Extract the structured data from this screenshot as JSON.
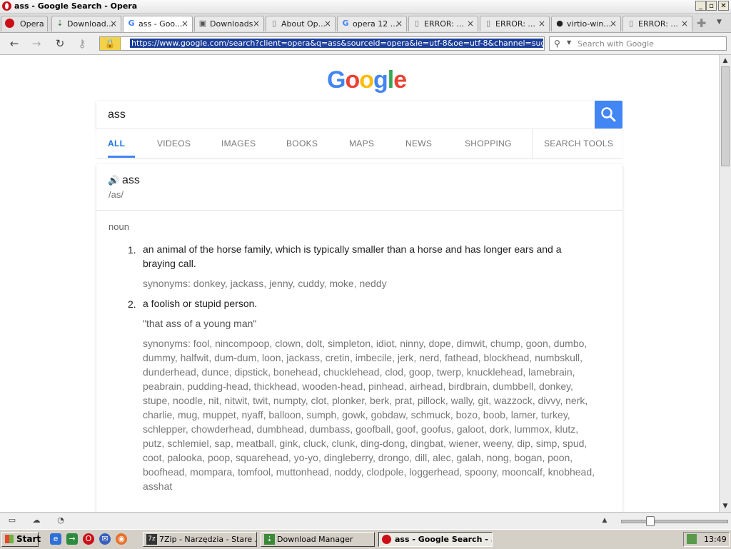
{
  "window": {
    "title": "ass - Google Search - Opera",
    "buttons": {
      "minimize": "_",
      "maximize": "▫",
      "close": "✕"
    }
  },
  "tabs": [
    {
      "label": "Opera",
      "icon": "opera-menu-icon"
    },
    {
      "label": "Download...",
      "icon": "download-icon"
    },
    {
      "label": "ass - Goo...",
      "icon": "google-icon",
      "active": true
    },
    {
      "label": "Downloads",
      "icon": "downloads-icon"
    },
    {
      "label": "About Op...",
      "icon": "page-icon"
    },
    {
      "label": "opera 12 ...",
      "icon": "google-icon"
    },
    {
      "label": "ERROR: ...",
      "icon": "page-icon"
    },
    {
      "label": "ERROR: ...",
      "icon": "page-icon"
    },
    {
      "label": "virtio-win...",
      "icon": "github-icon"
    },
    {
      "label": "ERROR: ...",
      "icon": "page-icon"
    }
  ],
  "addressbar": {
    "url": "https://www.google.com/search?client=opera&q=ass&sourceid=opera&ie=utf-8&oe=utf-8&channel=suggest&safe=ac",
    "search_placeholder": "Search with Google"
  },
  "google": {
    "logo": [
      "G",
      "o",
      "o",
      "g",
      "l",
      "e"
    ],
    "logo_colors": [
      "#4285f4",
      "#ea4335",
      "#fbbc05",
      "#4285f4",
      "#34a853",
      "#ea4335"
    ],
    "query": "ass",
    "tabs": [
      "ALL",
      "VIDEOS",
      "IMAGES",
      "BOOKS",
      "MAPS",
      "NEWS",
      "SHOPPING"
    ],
    "search_tools": "SEARCH TOOLS",
    "accent": "#4285f4"
  },
  "dictionary": {
    "word": "ass",
    "phonetic": "/as/",
    "part_of_speech": "noun",
    "definitions": [
      {
        "num": "1.",
        "text": "an animal of the horse family, which is typically smaller than a horse and has longer ears and a braying call.",
        "synonyms": "synonyms: donkey, jackass, jenny, cuddy, moke, neddy"
      },
      {
        "num": "2.",
        "text": "a foolish or stupid person.",
        "example": "\"that ass of a young man\"",
        "synonyms": "synonyms: fool, nincompoop, clown, dolt, simpleton, idiot, ninny, dope, dimwit, chump, goon, dumbo, dummy, halfwit, dum-dum, loon, jackass, cretin, imbecile, jerk, nerd, fathead, blockhead, numbskull, dunderhead, dunce, dipstick, bonehead, chucklehead, clod, goop, twerp, knucklehead, lamebrain, peabrain, pudding-head, thickhead, wooden-head, pinhead, airhead, birdbrain, dumbbell, donkey, stupe, noodle, nit, nitwit, twit, numpty, clot, plonker, berk, prat, pillock, wally, git, wazzock, divvy, nerk, charlie, mug, muppet, nyaff, balloon, sumph, gowk, gobdaw, schmuck, bozo, boob, lamer, turkey, schlepper, chowderhead, dumbhead, dumbass, goofball, goof, goofus, galoot, dork, lummox, klutz, putz, schlemiel, sap, meatball, gink, cluck, clunk, ding-dong, dingbat, wiener, weeny, dip, simp, spud, coot, palooka, poop, squarehead, yo-yo, dingleberry, drongo, dill, alec, galah, nong, bogan, poon, boofhead, mompara, tomfool, muttonhead, noddy, clodpole, loggerhead, spoony, mooncalf, knobhead, asshat"
      }
    ]
  },
  "taskbar": {
    "start": "Start",
    "buttons": [
      {
        "label": "7Zip - Narzędzia - Stare ...",
        "icon": "7zip-icon"
      },
      {
        "label": "Download Manager",
        "icon": "download-manager-icon"
      },
      {
        "label": "ass - Google Search - ...",
        "icon": "opera-icon",
        "active": true
      }
    ],
    "clock": "13:49"
  }
}
